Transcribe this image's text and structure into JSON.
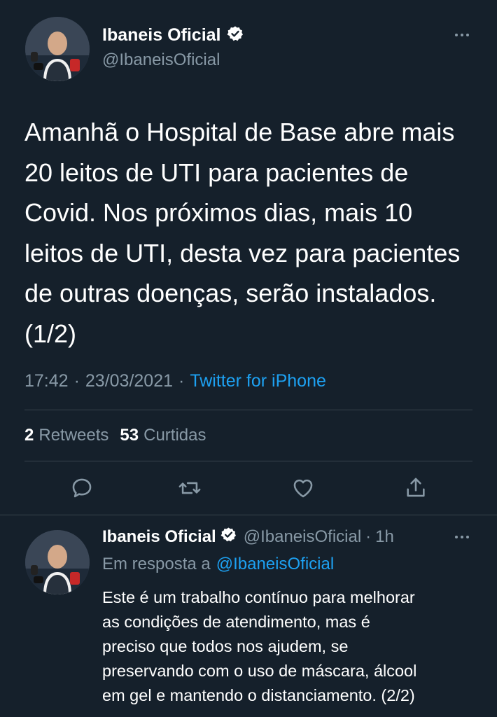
{
  "tweet": {
    "display_name": "Ibaneis Oficial",
    "handle": "@IbaneisOficial",
    "text_lines": [
      "Amanhã o Hospital de Base abre mais",
      "20 leitos de UTI para pacientes de",
      "Covid. Nos próximos dias, mais 10",
      "leitos de UTI, desta vez para pacientes",
      "de outras doenças, serão instalados.",
      "(1/2)"
    ],
    "time": "17:42",
    "date": "23/03/2021",
    "separator": "·",
    "source": "Twitter for iPhone",
    "retweets_count": "2",
    "retweets_label": "Retweets",
    "likes_count": "53",
    "likes_label": "Curtidas"
  },
  "reply": {
    "display_name": "Ibaneis Oficial",
    "handle": "@IbaneisOficial",
    "time_ago": "1h",
    "separator": "·",
    "in_reply_prefix": "Em resposta a",
    "in_reply_handle": "@IbaneisOficial",
    "text_lines": [
      "Este é um trabalho contínuo para melhorar",
      "as condições de atendimento, mas é",
      "preciso que todos nos ajudem, se",
      "preservando com o uso de máscara, álcool",
      "em gel e mantendo o distanciamento. (2/2)"
    ]
  },
  "colors": {
    "background": "#15202b",
    "muted": "#8899a6",
    "link": "#1da1f2",
    "divider": "#38444d"
  },
  "icons": {
    "actions": [
      "reply-icon",
      "retweet-icon",
      "like-icon",
      "share-icon"
    ],
    "verified": "verified-badge-icon",
    "more": "more-options-icon"
  }
}
